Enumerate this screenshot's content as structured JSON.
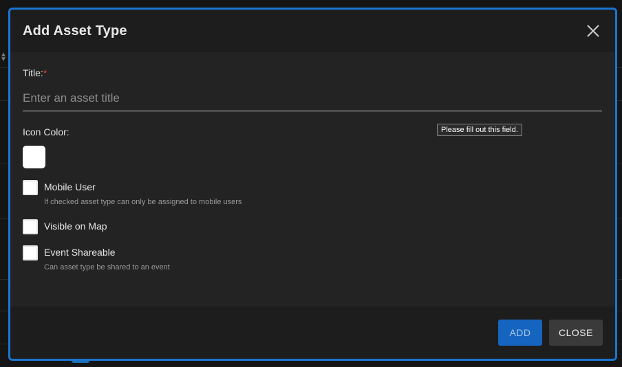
{
  "dialog": {
    "title": "Add Asset Type",
    "close_icon": "close-icon"
  },
  "form": {
    "title_label": "Title:",
    "required_marker": "*",
    "title_value": "",
    "title_placeholder": "Enter an asset title",
    "validation_tooltip": "Please fill out this field.",
    "icon_color_label": "Icon Color:",
    "icon_color_value": "#ffffff",
    "checkboxes": [
      {
        "label": "Mobile User",
        "help": "If checked asset type can only be assigned to mobile users",
        "checked": false
      },
      {
        "label": "Visible on Map",
        "help": "",
        "checked": false
      },
      {
        "label": "Event Shareable",
        "help": "Can asset type be shared to an event",
        "checked": false
      }
    ]
  },
  "footer": {
    "add_label": "ADD",
    "close_label": "CLOSE"
  },
  "colors": {
    "accent": "#1976d2",
    "add_button": "#1565c0",
    "required": "#e53935",
    "dialog_bg": "#232323"
  }
}
